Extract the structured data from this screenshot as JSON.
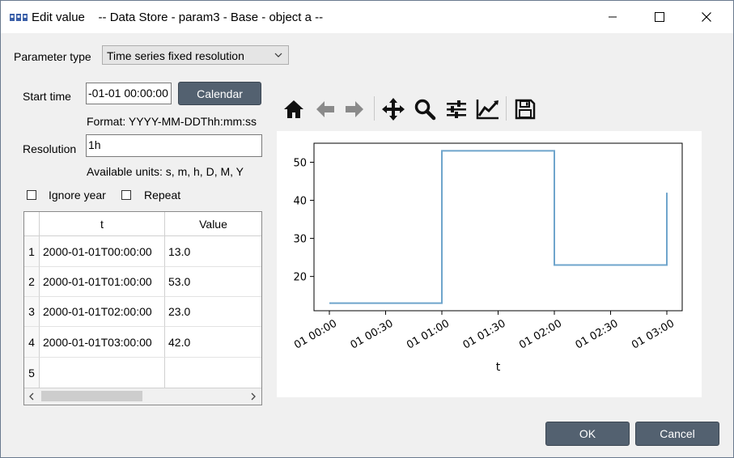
{
  "window": {
    "title": "Edit value    -- Data Store - param3 - Base - object a --"
  },
  "parameter_type": {
    "label": "Parameter type",
    "selected": "Time series fixed resolution"
  },
  "start_time": {
    "label": "Start time",
    "value": "-01-01 00:00:00",
    "calendar_button": "Calendar",
    "format_hint": "Format: YYYY-MM-DDThh:mm:ss"
  },
  "resolution": {
    "label": "Resolution",
    "value": "1h",
    "units_hint": "Available units: s, m, h, D, M, Y"
  },
  "options": {
    "ignore_year": "Ignore year",
    "repeat": "Repeat"
  },
  "table": {
    "headers": [
      "t",
      "Value"
    ],
    "rows": [
      {
        "index": "1",
        "t": "2000-01-01T00:00:00",
        "value": "13.0"
      },
      {
        "index": "2",
        "t": "2000-01-01T01:00:00",
        "value": "53.0"
      },
      {
        "index": "3",
        "t": "2000-01-01T02:00:00",
        "value": "23.0"
      },
      {
        "index": "4",
        "t": "2000-01-01T03:00:00",
        "value": "42.0"
      },
      {
        "index": "5",
        "t": "",
        "value": ""
      }
    ]
  },
  "toolbar": {
    "icons": [
      "home-icon",
      "back-icon",
      "forward-icon",
      "pan-icon",
      "zoom-icon",
      "configure-subplots-icon",
      "edit-axis-icon",
      "save-icon"
    ]
  },
  "chart_data": {
    "type": "line",
    "step": "post",
    "xlabel": "t",
    "ylabel": "",
    "title": "",
    "x": [
      "2000-01-01T00:00:00",
      "2000-01-01T01:00:00",
      "2000-01-01T02:00:00",
      "2000-01-01T03:00:00"
    ],
    "y": [
      13.0,
      53.0,
      23.0,
      42.0
    ],
    "xlim": [
      "2000-01-01T00:00:00",
      "2000-01-01T03:00:00"
    ],
    "ylim": [
      11.0,
      55.0
    ],
    "x_ticks": [
      "01 00:00",
      "01 00:30",
      "01 01:00",
      "01 01:30",
      "01 02:00",
      "01 02:30",
      "01 03:00"
    ],
    "y_ticks": [
      20,
      30,
      40,
      50
    ],
    "line_color": "#6fa5cc",
    "grid": false
  },
  "buttons": {
    "ok": "OK",
    "cancel": "Cancel"
  },
  "colors": {
    "button_dark": "#536170",
    "window_bg": "#f0f0f0"
  }
}
